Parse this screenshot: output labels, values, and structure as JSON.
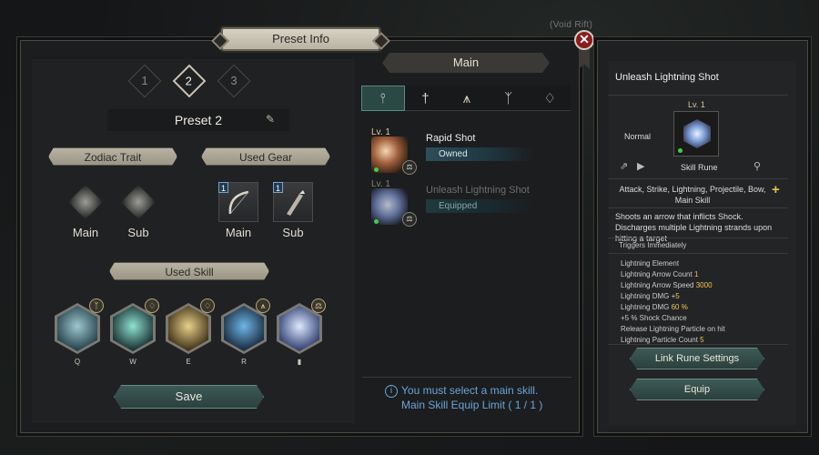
{
  "background_hint": "(Void Rift)",
  "window": {
    "title": "Preset Info",
    "close_icon": "✕"
  },
  "presets": {
    "tabs": [
      "1",
      "2",
      "3"
    ],
    "active_index": 1,
    "name": "Preset 2"
  },
  "sections": {
    "zodiac": {
      "title": "Zodiac Trait",
      "slots": [
        "Main",
        "Sub"
      ]
    },
    "gear": {
      "title": "Used Gear",
      "slots": [
        {
          "label": "Main",
          "badge": "1"
        },
        {
          "label": "Sub",
          "badge": "1"
        }
      ]
    },
    "used_skill": {
      "title": "Used Skill",
      "skills": [
        {
          "key": "Q",
          "colors": [
            "#9fc7cf",
            "#2c4a52"
          ]
        },
        {
          "key": "W",
          "colors": [
            "#8fe2d2",
            "#1f3a3a"
          ]
        },
        {
          "key": "E",
          "colors": [
            "#e8d08a",
            "#4a3b1e"
          ]
        },
        {
          "key": "R",
          "colors": [
            "#6fb6e8",
            "#1e3248"
          ]
        },
        {
          "key": "",
          "colors": [
            "#dfe8ff",
            "#3a4a7a"
          ]
        }
      ]
    },
    "save_label": "Save"
  },
  "main_panel": {
    "title": "Main",
    "type_tabs": [
      "⫯",
      "†",
      "⩚",
      "ᛉ",
      "♢"
    ],
    "skills": [
      {
        "level": "Lv. 1",
        "name": "Rapid Shot",
        "status": "Owned"
      },
      {
        "level": "Lv. 1",
        "name": "Unleash Lightning Shot",
        "status": "Equipped"
      }
    ],
    "notice": [
      "You must select a main skill.",
      "Main Skill Equip Limit ( 1 / 1 )"
    ]
  },
  "detail": {
    "title": "Unleash Lightning Shot",
    "level": "Lv.  1",
    "grade": "Normal",
    "rune_label": "Skill Rune",
    "tags": "Attack, Strike, Lightning, Projectile, Bow, Main Skill",
    "description": "Shoots an arrow that inflicts Shock. Discharges multiple Lightning strands upon hitting a target",
    "trigger": "Triggers Immediately",
    "stats": [
      {
        "label": "Lightning Element",
        "value": ""
      },
      {
        "label": "Lightning Arrow Count ",
        "value": "1"
      },
      {
        "label": "Lightning Arrow Speed ",
        "value": "3000"
      },
      {
        "label": "Lightning DMG +",
        "value": "5"
      },
      {
        "label": "Lightning DMG ",
        "value": "60 %"
      },
      {
        "label": "+5 % Shock Chance",
        "value": ""
      },
      {
        "label": "Release Lightning Particle on hit",
        "value": ""
      },
      {
        "label": "Lightning Particle Count ",
        "value": "5"
      }
    ],
    "buttons": {
      "link": "Link Rune Settings",
      "equip": "Equip"
    }
  }
}
